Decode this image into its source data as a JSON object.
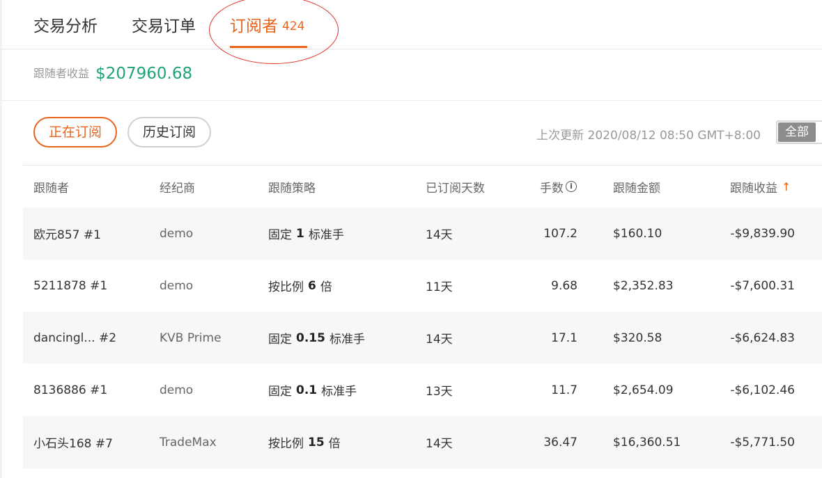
{
  "tabs": [
    {
      "label": "交易分析"
    },
    {
      "label": "交易订单"
    },
    {
      "label": "订阅者",
      "count": "424"
    }
  ],
  "earnings": {
    "label": "跟随者收益",
    "value": "$207960.68"
  },
  "filters": {
    "active_label": "正在订阅",
    "history_label": "历史订阅",
    "all_label": "全部"
  },
  "last_update": "上次更新 2020/08/12 08:50 GMT+8:00",
  "table": {
    "headers": [
      "跟随者",
      "经纪商",
      "跟随策略",
      "已订阅天数",
      "手数",
      "跟随金额",
      "跟随收益"
    ],
    "rows": [
      {
        "follower": "欧元857 #1",
        "broker": "demo",
        "strategy_pre": "固定",
        "strategy_val": "1",
        "strategy_post": "标准手",
        "days": "14天",
        "lots": "107.2",
        "amount": "$160.10",
        "profit": "-$9,839.90"
      },
      {
        "follower": "5211878 #1",
        "broker": "demo",
        "strategy_pre": "按比例",
        "strategy_val": "6",
        "strategy_post": "倍",
        "days": "11天",
        "lots": "9.68",
        "amount": "$2,352.83",
        "profit": "-$7,600.31"
      },
      {
        "follower": "dancingl... #2",
        "broker": "KVB Prime",
        "strategy_pre": "固定",
        "strategy_val": "0.15",
        "strategy_post": "标准手",
        "days": "14天",
        "lots": "17.1",
        "amount": "$320.58",
        "profit": "-$6,624.83"
      },
      {
        "follower": "8136886 #1",
        "broker": "demo",
        "strategy_pre": "固定",
        "strategy_val": "0.1",
        "strategy_post": "标准手",
        "days": "13天",
        "lots": "11.7",
        "amount": "$2,654.09",
        "profit": "-$6,102.46"
      },
      {
        "follower": "小石头168 #7",
        "broker": "TradeMax",
        "strategy_pre": "按比例",
        "strategy_val": "15",
        "strategy_post": "倍",
        "days": "14天",
        "lots": "36.47",
        "amount": "$16,360.51",
        "profit": "-$5,771.50"
      }
    ]
  },
  "colors": {
    "accent": "#e9631b",
    "positive": "#1fa377",
    "highlight_circle": "#e0302a"
  },
  "icons": {
    "lots_info": "info-icon",
    "sort": "sort-arrow-up-icon"
  }
}
